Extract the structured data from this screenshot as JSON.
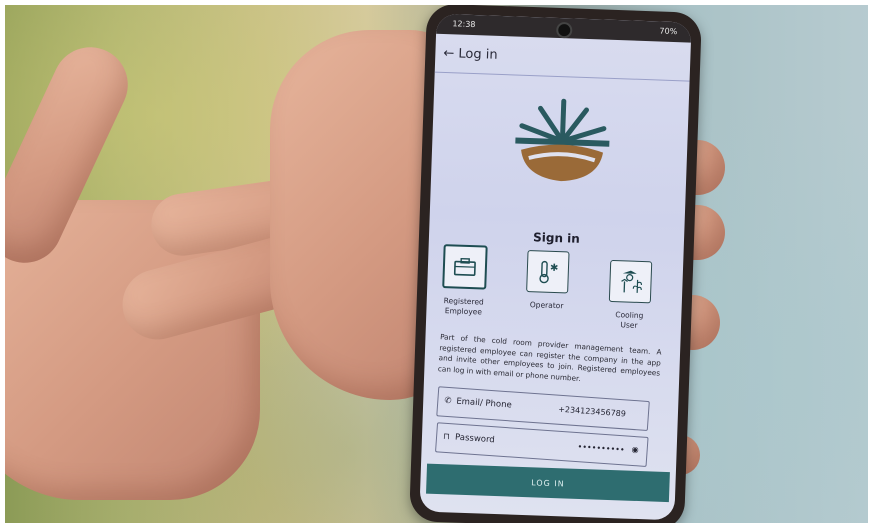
{
  "status_bar": {
    "time": "12:38",
    "battery": "70%"
  },
  "header": {
    "back_label": "← Log in"
  },
  "signin": {
    "title": "Sign in"
  },
  "roles": [
    {
      "label_line1": "Registered",
      "label_line2": "Employee",
      "icon": "briefcase-icon",
      "selected": true
    },
    {
      "label_line1": "Operator",
      "label_line2": "",
      "icon": "thermometer-snowflake-icon",
      "selected": false
    },
    {
      "label_line1": "Cooling",
      "label_line2": "User",
      "icon": "farmer-plant-icon",
      "selected": false
    }
  ],
  "description": "Part of the cold room provider management team. A registered employee can register the company in the app and invite other employees to join. Registered employees can log in with email or phone number.",
  "form": {
    "email_label": "Email/ Phone",
    "email_value": "+234123456789",
    "password_label": "Password",
    "password_value": "••••••••••"
  },
  "login_button": "LOG IN",
  "colors": {
    "brand_teal": "#2e6d70",
    "logo_teal": "#2a5a60",
    "logo_brown": "#9a6a38"
  }
}
